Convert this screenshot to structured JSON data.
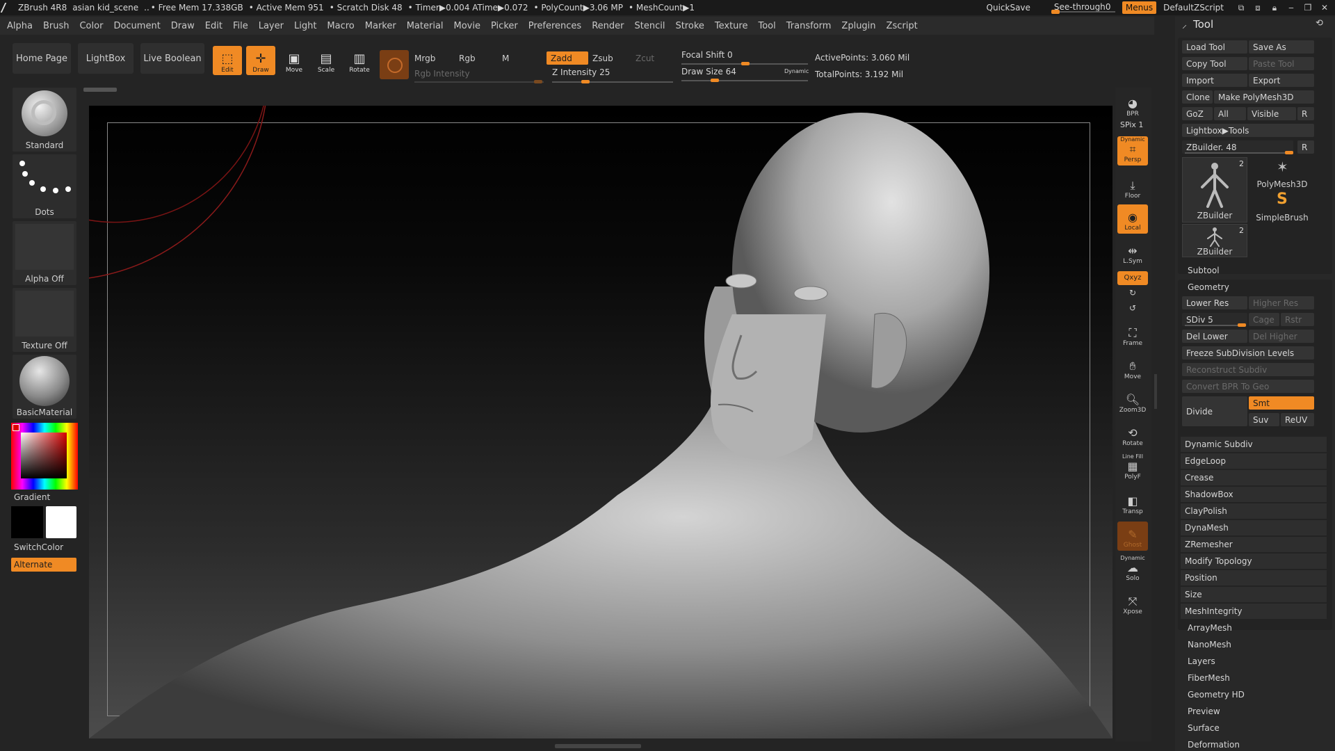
{
  "titlebar": {
    "app": "ZBrush 4R8",
    "scene": "asian kid_scene",
    "free_mem": "• Free Mem 17.338GB",
    "active_mem": "• Active Mem 951",
    "scratch": "• Scratch Disk 48",
    "timer": "• Timer▶0.004 ATime▶0.072",
    "polycount": "• PolyCount▶3.06 MP",
    "meshcount": "• MeshCount▶1",
    "quicksave": "QuickSave",
    "see_through": "See-through",
    "see_through_value": "0",
    "see_through_fraction": 0,
    "menus": "Menus",
    "script": "DefaultZScript"
  },
  "menubar": [
    "Alpha",
    "Brush",
    "Color",
    "Document",
    "Draw",
    "Edit",
    "File",
    "Layer",
    "Light",
    "Macro",
    "Marker",
    "Material",
    "Movie",
    "Picker",
    "Preferences",
    "Render",
    "Stencil",
    "Stroke",
    "Texture",
    "Tool",
    "Transform",
    "Zplugin",
    "Zscript"
  ],
  "toolbar": {
    "home": "Home Page",
    "lightbox": "LightBox",
    "live_boolean": "Live Boolean",
    "edit": "Edit",
    "draw": "Draw",
    "move": "Move",
    "scale": "Scale",
    "rotate": "Rotate",
    "mrgb": "Mrgb",
    "rgb": "Rgb",
    "m": "M",
    "rgb_intensity": "Rgb Intensity",
    "zadd": "Zadd",
    "zsub": "Zsub",
    "zcut": "Zcut",
    "z_intensity_label": "Z Intensity",
    "z_intensity_value": "25",
    "z_intensity_fraction": 0.25,
    "focal_shift_label": "Focal Shift",
    "focal_shift_value": "0",
    "draw_size_label": "Draw Size",
    "draw_size_value": "64",
    "dynamic": "Dynamic",
    "active_points": "ActivePoints: 3.060 Mil",
    "total_points": "TotalPoints: 3.192 Mil"
  },
  "leftshelf": {
    "brush": "Standard",
    "stroke": "Dots",
    "alpha": "Alpha Off",
    "texture": "Texture Off",
    "material": "BasicMaterial",
    "gradient": "Gradient",
    "switchcolor": "SwitchColor",
    "alternate": "Alternate"
  },
  "rightshelf": {
    "bpr": "BPR",
    "spix": "SPix 1",
    "dynamic": "Dynamic",
    "persp": "Persp",
    "floor": "Floor",
    "local": "Local",
    "lsym": "L.Sym",
    "xyz": "Qxyz",
    "frame": "Frame",
    "move": "Move",
    "zoom3d": "Zoom3D",
    "rotate": "Rotate",
    "linefill": "Line Fill",
    "polyf": "PolyF",
    "transp": "Transp",
    "ghost": "Ghost",
    "dynamic2": "Dynamic",
    "solo": "Solo",
    "xpose": "Xpose"
  },
  "tool": {
    "title": "Tool",
    "load_tool": "Load Tool",
    "save_as": "Save As",
    "copy_tool": "Copy Tool",
    "paste_tool": "Paste Tool",
    "import": "Import",
    "export": "Export",
    "clone": "Clone",
    "make_polymesh": "Make PolyMesh3D",
    "goz": "GoZ",
    "all": "All",
    "visible": "Visible",
    "r": "R",
    "lightbox_tools": "Lightbox▶Tools",
    "zbuilder_label": "ZBuilder. 48",
    "r2": "R",
    "thumb1_label": "ZBuilder",
    "thumb1_count": "2",
    "thumb2_label": "PolyMesh3D",
    "thumb3_label": "SimpleBrush",
    "thumb4_label": "ZBuilder",
    "thumb4_count": "2",
    "subtool": "Subtool",
    "geometry": "Geometry",
    "lower_res": "Lower Res",
    "higher_res": "Higher Res",
    "sdiv": "SDiv 5",
    "cage": "Cage",
    "rstr": "Rstr",
    "del_lower": "Del Lower",
    "del_higher": "Del Higher",
    "freeze": "Freeze SubDivision Levels",
    "reconstruct": "Reconstruct Subdiv",
    "convert_bpr": "Convert BPR To Geo",
    "divide": "Divide",
    "smt": "Smt",
    "suv": "Suv",
    "reuv": "ReUV",
    "geometry_items": [
      "Dynamic Subdiv",
      "EdgeLoop",
      "Crease",
      "ShadowBox",
      "ClayPolish",
      "DynaMesh",
      "ZRemesher",
      "Modify Topology",
      "Position",
      "Size",
      "MeshIntegrity"
    ],
    "sub_items": [
      "ArrayMesh",
      "NanoMesh",
      "Layers",
      "FiberMesh",
      "Geometry HD",
      "Preview",
      "Surface",
      "Deformation"
    ]
  }
}
